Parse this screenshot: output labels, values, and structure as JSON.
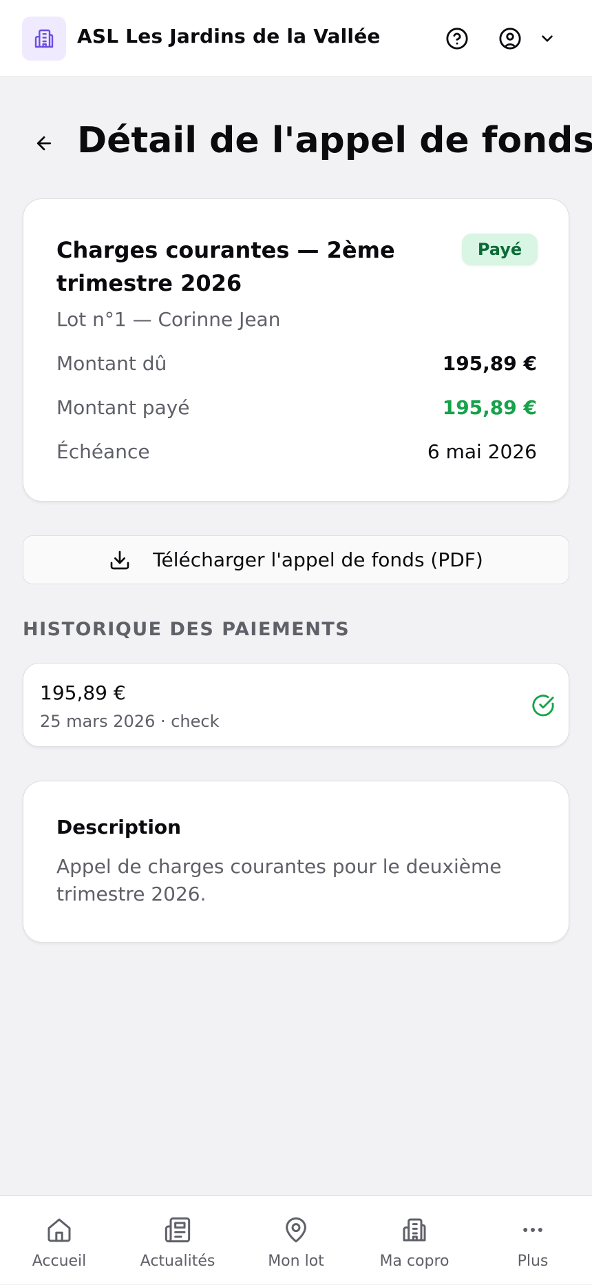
{
  "header": {
    "app_title": "ASL Les Jardins de la Vallée",
    "logo_icon": "building-icon",
    "help_icon": "help-circle-icon",
    "user_icon": "user-circle-icon",
    "dropdown_icon": "chevron-down-icon"
  },
  "page": {
    "title": "Détail de l'appel de fonds",
    "back_icon": "arrow-left-icon"
  },
  "summary": {
    "title": "Charges courantes — 2ème trimestre 2026",
    "status": "Payé",
    "lot": "Lot n°1 — Corinne Jean",
    "rows": [
      {
        "label": "Montant dû",
        "value": "195,89 €"
      },
      {
        "label": "Montant payé",
        "value": "195,89 €"
      },
      {
        "label": "Échéance",
        "value": "6 mai 2026"
      }
    ]
  },
  "download": {
    "label": "Télécharger l'appel de fonds (PDF)",
    "icon": "download-icon"
  },
  "history": {
    "heading": "HISTORIQUE DES PAIEMENTS",
    "payments": [
      {
        "amount": "195,89 €",
        "meta": "25 mars 2026 · check",
        "icon": "check-circle-icon"
      }
    ]
  },
  "description": {
    "title": "Description",
    "text": "Appel de charges courantes pour le deuxième trimestre 2026."
  },
  "nav": {
    "items": [
      {
        "label": "Accueil",
        "icon": "home-icon"
      },
      {
        "label": "Actualités",
        "icon": "newspaper-icon"
      },
      {
        "label": "Mon lot",
        "icon": "map-pin-icon"
      },
      {
        "label": "Ma copro",
        "icon": "building-icon"
      },
      {
        "label": "Plus",
        "icon": "more-horizontal-icon"
      }
    ]
  },
  "colors": {
    "accent_purple": "#6d4ce0",
    "paid_green": "#16a34a",
    "badge_bg": "#d9f5e3",
    "badge_text": "#0b6b37",
    "muted_text": "#5f6068",
    "page_bg": "#f2f2f4"
  }
}
